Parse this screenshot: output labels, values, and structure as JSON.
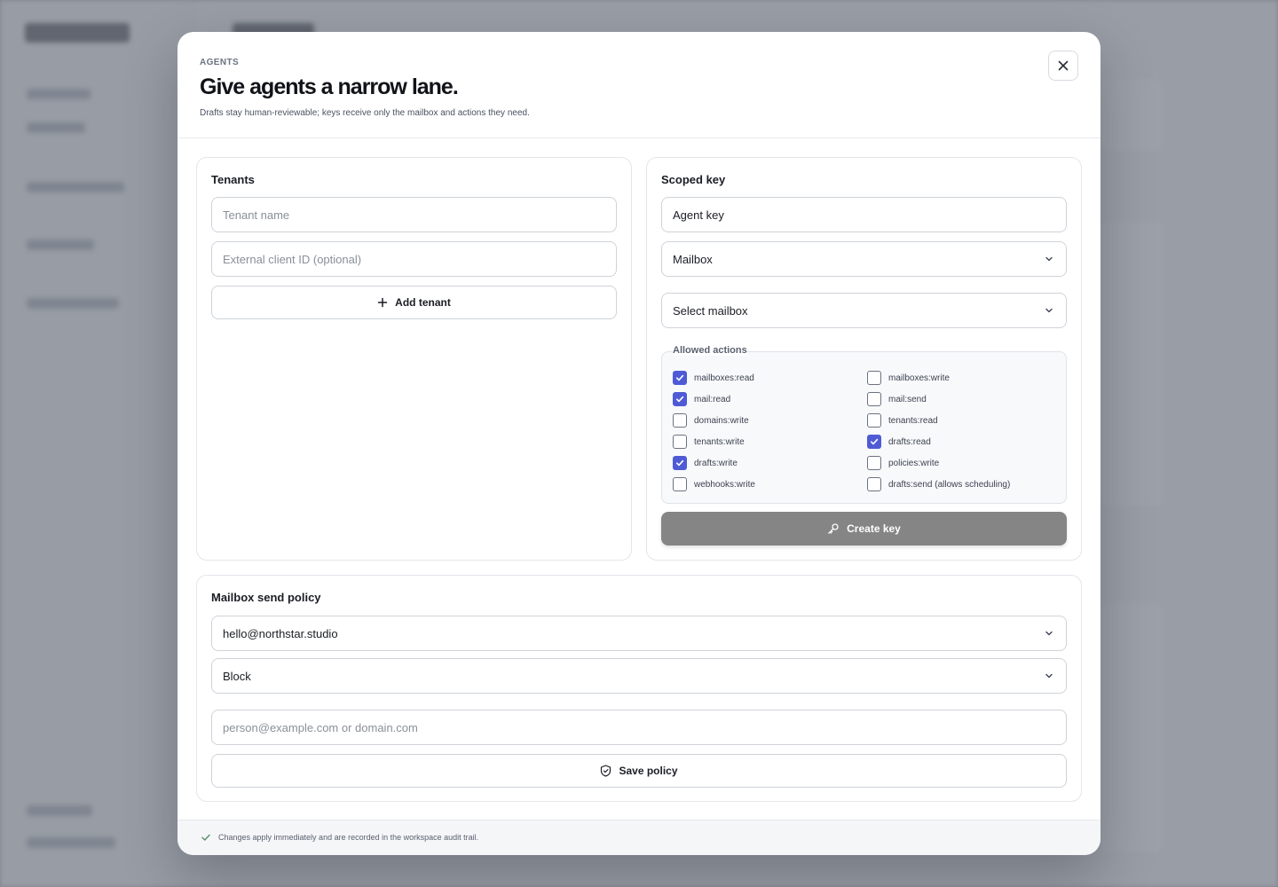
{
  "modal": {
    "eyebrow": "AGENTS",
    "title": "Give agents a narrow lane.",
    "subtitle": "Drafts stay human-reviewable; keys receive only the mailbox and actions they need.",
    "close_icon": "close-icon"
  },
  "tenants": {
    "title": "Tenants",
    "name_placeholder": "Tenant name",
    "external_id_placeholder": "External client ID (optional)",
    "add_button": "Add tenant",
    "add_icon": "plus-icon"
  },
  "scoped_key": {
    "title": "Scoped key",
    "key_name_value": "Agent key",
    "scope_type_value": "Mailbox",
    "mailbox_select_value": "Select mailbox",
    "allowed_actions_label": "Allowed actions",
    "actions": [
      {
        "label": "mailboxes:read",
        "checked": true
      },
      {
        "label": "mailboxes:write",
        "checked": false
      },
      {
        "label": "mail:read",
        "checked": true
      },
      {
        "label": "mail:send",
        "checked": false
      },
      {
        "label": "domains:write",
        "checked": false
      },
      {
        "label": "tenants:read",
        "checked": false
      },
      {
        "label": "tenants:write",
        "checked": false
      },
      {
        "label": "drafts:read",
        "checked": true
      },
      {
        "label": "drafts:write",
        "checked": true
      },
      {
        "label": "policies:write",
        "checked": false
      },
      {
        "label": "webhooks:write",
        "checked": false
      },
      {
        "label": "drafts:send (allows scheduling)",
        "checked": false
      }
    ],
    "create_button": "Create key",
    "create_icon": "key-icon"
  },
  "send_policy": {
    "title": "Mailbox send policy",
    "mailbox_value": "hello@northstar.studio",
    "mode_value": "Block",
    "target_placeholder": "person@example.com or domain.com",
    "save_button": "Save policy",
    "save_icon": "shield-check-icon"
  },
  "footer": {
    "note": "Changes apply immediately and are recorded in the workspace audit trail.",
    "icon": "check-icon"
  },
  "colors": {
    "accent_checkbox": "#4f5bd5",
    "primary_button_disabled": "#858585",
    "overlay": "#767b86"
  }
}
